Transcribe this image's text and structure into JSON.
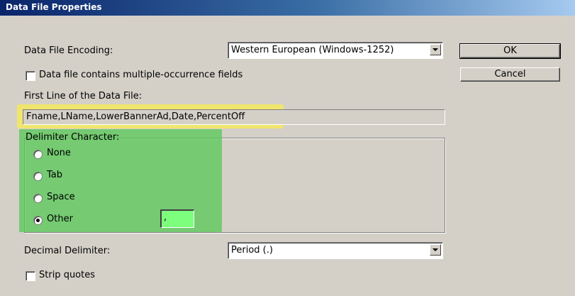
{
  "window": {
    "title": "Data File Properties"
  },
  "encoding": {
    "label": "Data File Encoding:",
    "value": "Western European (Windows-1252)"
  },
  "multiple_occurrence": {
    "label": "Data file contains multiple-occurrence fields",
    "checked": false
  },
  "first_line": {
    "label": "First Line of the Data File:",
    "value": "Fname,LName,LowerBannerAd,Date,PercentOff"
  },
  "delimiter": {
    "label": "Delimiter Character:",
    "options": [
      "None",
      "Tab",
      "Space",
      "Other"
    ],
    "selected": "Other",
    "other_value": ","
  },
  "decimal_delimiter": {
    "label": "Decimal Delimiter:",
    "value": "Period (.)"
  },
  "strip_quotes": {
    "label": "Strip quotes",
    "checked": false
  },
  "buttons": {
    "ok": "OK",
    "cancel": "Cancel"
  },
  "colors": {
    "dialog_bg": "#d4d0c8",
    "title_start": "#0a246a",
    "title_end": "#a6caf0",
    "highlight_yellow": "#fff03c",
    "highlight_green": "#50c850",
    "other_field": "#7dff7d"
  }
}
